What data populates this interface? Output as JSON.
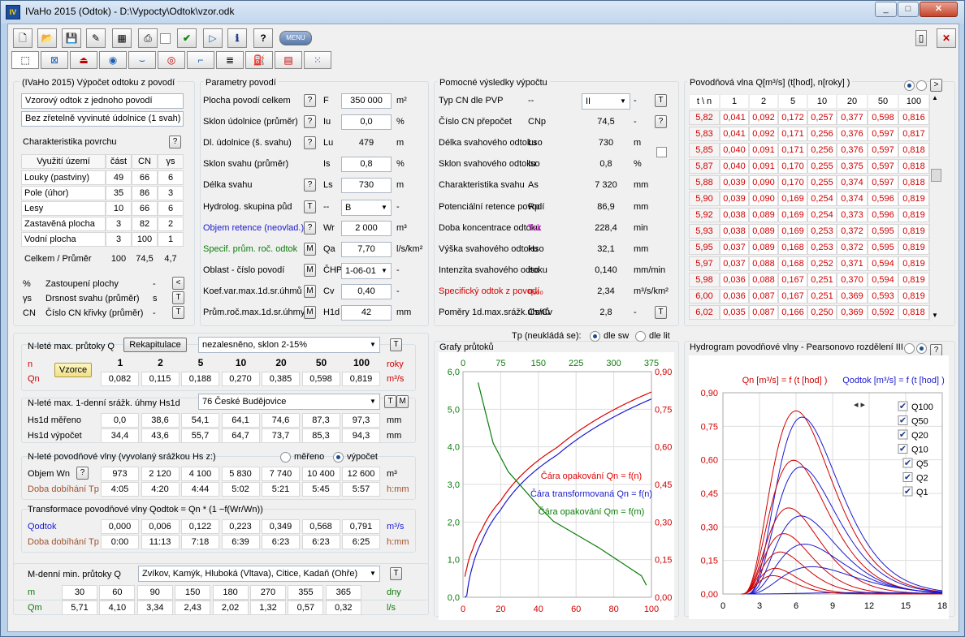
{
  "window": {
    "title": "IVaHo 2015 (Odtok) - D:\\Vypocty\\Odtok\\vzor.odk",
    "app_icon": "IVaHo"
  },
  "toolbar": {
    "menu_label": "MENU"
  },
  "header": {
    "title": "(IVaHo 2015) Výpočet odtoku z povodí",
    "project": "Vzorový odtok z jednoho povodí",
    "subtitle": "Bez zřetelně vyvinuté údolnice (1 svah)"
  },
  "surface": {
    "title": "Charakteristika povrchu",
    "cols": [
      "Využití území",
      "část",
      "CN",
      "γs"
    ],
    "rows": [
      [
        "Louky (pastviny)",
        "49",
        "66",
        "6"
      ],
      [
        "Pole (úhor)",
        "35",
        "86",
        "3"
      ],
      [
        "Lesy",
        "10",
        "66",
        "6"
      ],
      [
        "Zastavěná plocha",
        "3",
        "82",
        "2"
      ],
      [
        "Vodní plocha",
        "3",
        "100",
        "1"
      ]
    ],
    "total": [
      "Celkem / Průměr",
      "100",
      "74,5",
      "4,7"
    ],
    "legend": [
      [
        "%",
        "Zastoupení plochy",
        "-"
      ],
      [
        "γs",
        "Drsnost svahu (průměr)",
        "s"
      ],
      [
        "CN",
        "Číslo CN křivky (průměr)",
        "-"
      ]
    ]
  },
  "params": {
    "title": "Parametry povodí",
    "rows": [
      {
        "label": "Plocha povodí celkem",
        "sym": "F",
        "value": "350 000",
        "unit": "m²",
        "color": "black",
        "btn": "?"
      },
      {
        "label": "Sklon údolnice (průměr)",
        "sym": "Iu",
        "value": "0,0",
        "unit": "%",
        "color": "black",
        "btn": "?"
      },
      {
        "label": "Dl. údolnice (š. svahu)",
        "sym": "Lu",
        "value": "479",
        "unit": "m",
        "color": "black",
        "btn": "?"
      },
      {
        "label": "Sklon svahu (průměr)",
        "sym": "Is",
        "value": "0,8",
        "unit": "%",
        "color": "black",
        "btn": ""
      },
      {
        "label": "Délka svahu",
        "sym": "Ls",
        "value": "730",
        "unit": "m",
        "color": "black",
        "btn": "?"
      },
      {
        "label": "Hydrolog. skupina půd",
        "sym": "--",
        "value": "B",
        "unit": "-",
        "color": "black",
        "btn": "T"
      },
      {
        "label": "Objem retence (neovlad.)",
        "sym": "Wr",
        "value": "2 000",
        "unit": "m³",
        "color": "blue",
        "btn": "?"
      },
      {
        "label": "Specif. prům. roč. odtok",
        "sym": "Qa",
        "value": "7,70",
        "unit": "l/s/km²",
        "color": "green",
        "btn": "M"
      },
      {
        "label": "Oblast - číslo povodí",
        "sym": "ČHP",
        "value": "1-06-01",
        "unit": "-",
        "color": "black",
        "btn": "M"
      },
      {
        "label": "Koef.var.max.1d.sr.úhmů",
        "sym": "Cv",
        "value": "0,40",
        "unit": "-",
        "color": "black",
        "btn": "M"
      },
      {
        "label": "Prům.roč.max.1d.sr.úhmy",
        "sym": "H1d",
        "value": "42",
        "unit": "mm",
        "color": "black",
        "btn": "M"
      }
    ]
  },
  "aux": {
    "title": "Pomocné výsledky výpočtu",
    "rows": [
      {
        "label": "Typ CN dle PVP",
        "sym": "--",
        "value": "II",
        "unit": "-",
        "color": "black",
        "btn": "T"
      },
      {
        "label": "Číslo CN přepočet",
        "sym": "CNp",
        "value": "74,5",
        "unit": "-",
        "color": "black",
        "btn": "?"
      },
      {
        "label": "Délka svahového odtoku",
        "sym": "Lso",
        "value": "730",
        "unit": "m",
        "color": "black",
        "btn": ""
      },
      {
        "label": "Sklon svahového odtoku",
        "sym": "Iso",
        "value": "0,8",
        "unit": "%",
        "color": "black",
        "btn": ""
      },
      {
        "label": "Charakteristika svahu",
        "sym": "As",
        "value": "7 320",
        "unit": "mm",
        "color": "black",
        "btn": ""
      },
      {
        "label": "Potenciální retence povodí",
        "sym": "Rp",
        "value": "86,9",
        "unit": "mm",
        "color": "black",
        "btn": ""
      },
      {
        "label": "Doba koncentrace odtoku",
        "sym": "Tsk",
        "value": "228,4",
        "unit": "min",
        "color": "black",
        "btn": ""
      },
      {
        "label": "Výška svahového odtoku",
        "sym": "Hso",
        "value": "32,1",
        "unit": "mm",
        "color": "black",
        "btn": ""
      },
      {
        "label": "Intenzita svahového odtoku",
        "sym": "iso",
        "value": "0,140",
        "unit": "mm/min",
        "color": "black",
        "btn": ""
      },
      {
        "label": "Specifický odtok z povodí",
        "sym": "q₁₀₀",
        "value": "2,34",
        "unit": "m³/s/km²",
        "color": "red",
        "btn": ""
      },
      {
        "label": "Poměry 1d.max.srážk.úhmů",
        "sym": "Cs/Cv",
        "value": "2,8",
        "unit": "-",
        "color": "black",
        "btn": "T"
      }
    ]
  },
  "wave": {
    "title": "Povodňová vlna Q[m³/s]   (t[hod], n[roky] )",
    "cols": [
      "t \\ n",
      "1",
      "2",
      "5",
      "10",
      "20",
      "50",
      "100"
    ],
    "rows": [
      [
        "5,82",
        "0,041",
        "0,092",
        "0,172",
        "0,257",
        "0,377",
        "0,598",
        "0,816"
      ],
      [
        "5,83",
        "0,041",
        "0,092",
        "0,171",
        "0,256",
        "0,376",
        "0,597",
        "0,817"
      ],
      [
        "5,85",
        "0,040",
        "0,091",
        "0,171",
        "0,256",
        "0,376",
        "0,597",
        "0,818"
      ],
      [
        "5,87",
        "0,040",
        "0,091",
        "0,170",
        "0,255",
        "0,375",
        "0,597",
        "0,818"
      ],
      [
        "5,88",
        "0,039",
        "0,090",
        "0,170",
        "0,255",
        "0,374",
        "0,597",
        "0,818"
      ],
      [
        "5,90",
        "0,039",
        "0,090",
        "0,169",
        "0,254",
        "0,374",
        "0,596",
        "0,819"
      ],
      [
        "5,92",
        "0,038",
        "0,089",
        "0,169",
        "0,254",
        "0,373",
        "0,596",
        "0,819"
      ],
      [
        "5,93",
        "0,038",
        "0,089",
        "0,169",
        "0,253",
        "0,372",
        "0,595",
        "0,819"
      ],
      [
        "5,95",
        "0,037",
        "0,089",
        "0,168",
        "0,253",
        "0,372",
        "0,595",
        "0,819"
      ],
      [
        "5,97",
        "0,037",
        "0,088",
        "0,168",
        "0,252",
        "0,371",
        "0,594",
        "0,819"
      ],
      [
        "5,98",
        "0,036",
        "0,088",
        "0,167",
        "0,251",
        "0,370",
        "0,594",
        "0,819"
      ],
      [
        "6,00",
        "0,036",
        "0,087",
        "0,167",
        "0,251",
        "0,369",
        "0,593",
        "0,819"
      ],
      [
        "6,02",
        "0,035",
        "0,087",
        "0,166",
        "0,250",
        "0,369",
        "0,592",
        "0,818"
      ]
    ]
  },
  "nflows": {
    "title": "N-leté max. průtoky Q",
    "recap": "Rekapitulace",
    "combo": "nezalesněno, sklon 2-15%",
    "formula_btn": "Vzorce",
    "n_label": "n",
    "q_label": "Qn",
    "n": [
      "1",
      "2",
      "5",
      "10",
      "20",
      "50",
      "100"
    ],
    "q": [
      "0,082",
      "0,115",
      "0,188",
      "0,270",
      "0,385",
      "0,598",
      "0,819"
    ],
    "n_unit": "roky",
    "q_unit": "m³/s"
  },
  "rain": {
    "title": "N-leté max. 1-denní srážk. úhmy Hs1d",
    "station": "76  České Budějovice",
    "measured_label": "Hs1d měřeno",
    "calc_label": "Hs1d výpočet",
    "measured": [
      "0,0",
      "38,6",
      "54,1",
      "64,1",
      "74,6",
      "87,3",
      "97,3"
    ],
    "calc": [
      "34,4",
      "43,6",
      "55,7",
      "64,7",
      "73,7",
      "85,3",
      "94,3"
    ],
    "unit": "mm"
  },
  "waves": {
    "title": "N-leté povodňové vlny (vyvolaný srážkou Hs z:)",
    "opt1": "měřeno",
    "opt2": "výpočet",
    "vol_label": "Objem Wn",
    "time_label": "Doba dobíhání Tp",
    "vol": [
      "973",
      "2 120",
      "4 100",
      "5 830",
      "7 740",
      "10 400",
      "12 600"
    ],
    "time": [
      "4:05",
      "4:20",
      "4:44",
      "5:02",
      "5:21",
      "5:45",
      "5:57"
    ],
    "vol_unit": "m³",
    "time_unit": "h:mm"
  },
  "transform": {
    "title": "Transformace povodňové vlny Qodtok = Qn * (1 −f(Wr/Wn))",
    "q_label": "Qodtok",
    "time_label": "Doba dobíhání Tp",
    "q": [
      "0,000",
      "0,006",
      "0,122",
      "0,223",
      "0,349",
      "0,568",
      "0,791"
    ],
    "time": [
      "0:00",
      "11:13",
      "7:18",
      "6:39",
      "6:23",
      "6:23",
      "6:25"
    ],
    "q_unit": "m³/s",
    "time_unit": "h:mm"
  },
  "mday": {
    "title": "M-denní min. průtoky Q",
    "combo": "Zvíkov, Kamýk, Hluboká (Vltava), Citice, Kadaň (Ohře)",
    "m_label": "m",
    "q_label": "Qm",
    "m": [
      "30",
      "60",
      "90",
      "150",
      "180",
      "270",
      "355",
      "365"
    ],
    "q": [
      "5,71",
      "4,10",
      "3,34",
      "2,43",
      "2,02",
      "1,32",
      "0,57",
      "0,32"
    ],
    "m_unit": "dny",
    "q_unit": "l/s"
  },
  "graphs": {
    "title": "Grafy průtoků",
    "tp_label": "Tp (neukládá se):",
    "opt1": "dle sw",
    "opt2": "dle lit"
  },
  "hydro": {
    "title": "Hydrogram povodňové vlny - Pearsonovo rozdělení III",
    "qn_caption": "Qn [m³/s] = f (t [hod] )",
    "qodtok_caption": "Qodtok [m³/s] = f (t [hod] )",
    "checks": [
      "Q100",
      "Q50",
      "Q20",
      "Q10",
      "Q5",
      "Q2",
      "Q1"
    ]
  },
  "chart_data": [
    {
      "type": "line",
      "title": "Grafy průtoků",
      "x_bottom_ticks": [
        "0",
        "20",
        "40",
        "60",
        "80",
        "100"
      ],
      "x_top_ticks": [
        "0",
        "75",
        "150",
        "225",
        "300",
        "375"
      ],
      "y_left_ticks": [
        "0,0",
        "1,0",
        "2,0",
        "3,0",
        "4,0",
        "5,0",
        "6,0"
      ],
      "y_right_ticks": [
        "0,00",
        "0,15",
        "0,30",
        "0,45",
        "0,60",
        "0,75",
        "0,90"
      ],
      "xlim": [
        0,
        100
      ],
      "ylim_left": [
        0,
        6
      ],
      "ylim_right": [
        0,
        0.9
      ],
      "xlim_top": [
        0,
        375
      ],
      "series": [
        {
          "name": "Čára opakování Qn = f(n)",
          "axis": "right",
          "x": [
            1,
            2,
            5,
            10,
            20,
            50,
            100
          ],
          "y": [
            0.082,
            0.115,
            0.188,
            0.27,
            0.385,
            0.598,
            0.819
          ],
          "color": "#e00000"
        },
        {
          "name": "Čára transformovaná Qn = f(n)",
          "axis": "right",
          "x": [
            1,
            2,
            5,
            10,
            20,
            50,
            100
          ],
          "y": [
            0.0,
            0.006,
            0.122,
            0.223,
            0.349,
            0.568,
            0.791
          ],
          "color": "#1a1ad0"
        },
        {
          "name": "Čára opakování Qm = f(m)",
          "axis": "left",
          "x_top": [
            30,
            60,
            90,
            150,
            180,
            270,
            355,
            365
          ],
          "y": [
            5.71,
            4.1,
            3.34,
            2.43,
            2.02,
            1.32,
            0.57,
            0.32
          ],
          "color": "#0a7d0a"
        }
      ]
    },
    {
      "type": "line",
      "title": "Hydrogram povodňové vlny - Pearsonovo rozdělení III",
      "x_ticks": [
        "0",
        "3",
        "6",
        "9",
        "12",
        "15",
        "18"
      ],
      "y_ticks": [
        "0,00",
        "0,15",
        "0,30",
        "0,45",
        "0,60",
        "0,75",
        "0,90"
      ],
      "xlim": [
        0,
        18
      ],
      "ylim": [
        0,
        0.9
      ],
      "series": [
        {
          "name": "Q100",
          "peak": 0.819,
          "tpeak": 6.0,
          "peak_odtok": 0.791,
          "tpeak_odtok": 6.5
        },
        {
          "name": "Q50",
          "peak": 0.598,
          "tpeak": 5.8,
          "peak_odtok": 0.568,
          "tpeak_odtok": 6.4
        },
        {
          "name": "Q20",
          "peak": 0.385,
          "tpeak": 5.4,
          "peak_odtok": 0.349,
          "tpeak_odtok": 6.4
        },
        {
          "name": "Q10",
          "peak": 0.27,
          "tpeak": 5.0,
          "peak_odtok": 0.223,
          "tpeak_odtok": 6.7
        },
        {
          "name": "Q5",
          "peak": 0.188,
          "tpeak": 4.7,
          "peak_odtok": 0.122,
          "tpeak_odtok": 7.3
        },
        {
          "name": "Q2",
          "peak": 0.115,
          "tpeak": 4.3,
          "peak_odtok": 0.006,
          "tpeak_odtok": 11.2
        },
        {
          "name": "Q1",
          "peak": 0.082,
          "tpeak": 4.1,
          "peak_odtok": 0.0,
          "tpeak_odtok": 0.0
        }
      ]
    }
  ]
}
